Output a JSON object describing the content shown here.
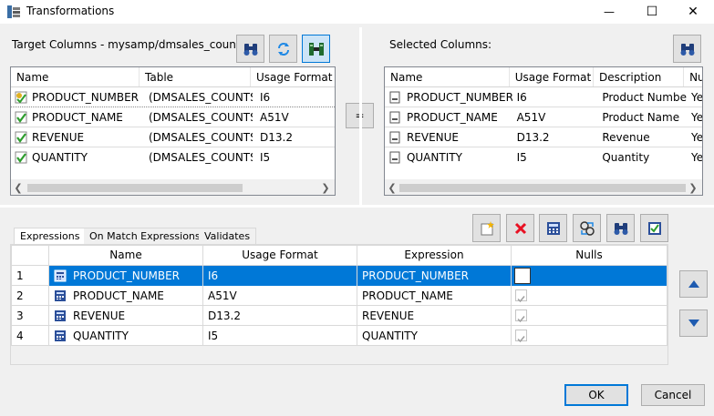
{
  "window": {
    "title": "Transformations",
    "minimize_glyph": "—",
    "maximize_glyph": "☐",
    "close_glyph": "✕"
  },
  "target": {
    "label": "Target Columns - mysamp/dmsales_counts",
    "columns": [
      "Name",
      "Table",
      "Usage Format"
    ],
    "rows": [
      {
        "name": "PRODUCT_NUMBER",
        "table": "(DMSALES_COUNTS)",
        "format": "I6",
        "icon": "key-check-icon"
      },
      {
        "name": "PRODUCT_NAME",
        "table": "(DMSALES_COUNTS)",
        "format": "A51V",
        "icon": "check-field-icon"
      },
      {
        "name": "REVENUE",
        "table": "(DMSALES_COUNTS)",
        "format": "D13.2",
        "icon": "check-field-icon"
      },
      {
        "name": "QUANTITY",
        "table": "(DMSALES_COUNTS)",
        "format": "I5",
        "icon": "check-field-icon"
      }
    ]
  },
  "equals_button": "=",
  "selected": {
    "label": "Selected Columns:",
    "columns": [
      "Name",
      "Usage Format",
      "Description",
      "Nu"
    ],
    "rows": [
      {
        "name": "PRODUCT_NUMBER",
        "format": "I6",
        "description": "Product Number",
        "nu": "Ye"
      },
      {
        "name": "PRODUCT_NAME",
        "format": "A51V",
        "description": "Product Name",
        "nu": "Ye"
      },
      {
        "name": "REVENUE",
        "format": "D13.2",
        "description": "Revenue",
        "nu": "Ye"
      },
      {
        "name": "QUANTITY",
        "format": "I5",
        "description": "Quantity",
        "nu": "Ye"
      }
    ]
  },
  "tabs": [
    "Expressions",
    "On Match Expressions",
    "Validates"
  ],
  "expressions": {
    "columns": [
      "Name",
      "Usage Format",
      "Expression",
      "Nulls"
    ],
    "rows": [
      {
        "num": "1",
        "name": "PRODUCT_NUMBER",
        "format": "I6",
        "expression": "PRODUCT_NUMBER",
        "nulls": false
      },
      {
        "num": "2",
        "name": "PRODUCT_NAME",
        "format": "A51V",
        "expression": "PRODUCT_NAME",
        "nulls": true
      },
      {
        "num": "3",
        "name": "REVENUE",
        "format": "D13.2",
        "expression": "REVENUE",
        "nulls": true
      },
      {
        "num": "4",
        "name": "QUANTITY",
        "format": "I5",
        "expression": "QUANTITY",
        "nulls": true
      }
    ]
  },
  "buttons": {
    "ok": "OK",
    "cancel": "Cancel"
  },
  "colors": {
    "selection": "#0078d7",
    "delete_red": "#e81123",
    "arrow_blue": "#1e5bb0"
  }
}
